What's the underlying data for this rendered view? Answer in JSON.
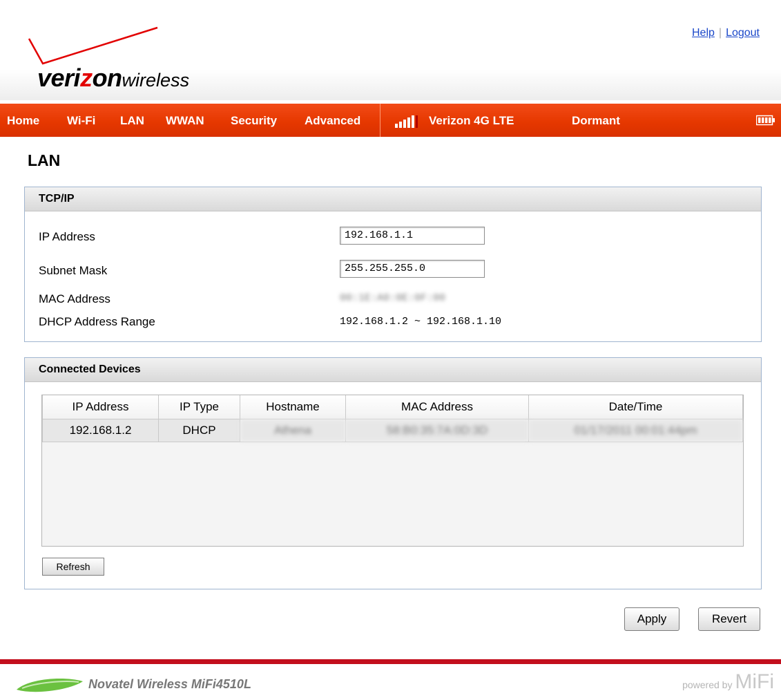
{
  "brand": {
    "name_left": "veri",
    "name_z": "z",
    "name_right": "on",
    "name_sub": "wireless",
    "accent_color": "#e63800"
  },
  "toplinks": {
    "help": "Help",
    "separator": "|",
    "logout": "Logout"
  },
  "nav": {
    "items": [
      "Home",
      "Wi-Fi",
      "LAN",
      "WWAN",
      "Security",
      "Advanced"
    ],
    "carrier": "Verizon  4G LTE",
    "status": "Dormant",
    "signal_icon": "signal-bars-icon",
    "battery_icon": "battery-icon"
  },
  "page": {
    "title": "LAN"
  },
  "tcpip": {
    "heading": "TCP/IP",
    "ip_label": "IP Address",
    "ip_value": "192.168.1.1",
    "subnet_label": "Subnet Mask",
    "subnet_value": "255.255.255.0",
    "mac_label": "MAC Address",
    "mac_value": "00:1E:A0:0E:0F:00",
    "dhcp_label": "DHCP Address Range",
    "dhcp_value": "192.168.1.2 ~ 192.168.1.10"
  },
  "devices": {
    "heading": "Connected Devices",
    "columns": [
      "IP Address",
      "IP Type",
      "Hostname",
      "MAC Address",
      "Date/Time"
    ],
    "rows": [
      [
        "192.168.1.2",
        "DHCP",
        "Athena",
        "58:B0:35:7A:0D:3D",
        "01/17/2011 00:01:44pm"
      ]
    ],
    "refresh": "Refresh"
  },
  "actions": {
    "apply": "Apply",
    "revert": "Revert"
  },
  "footer": {
    "product": "Novatel Wireless MiFi4510L",
    "powered_by": "powered by",
    "mifi": "MiFi"
  }
}
